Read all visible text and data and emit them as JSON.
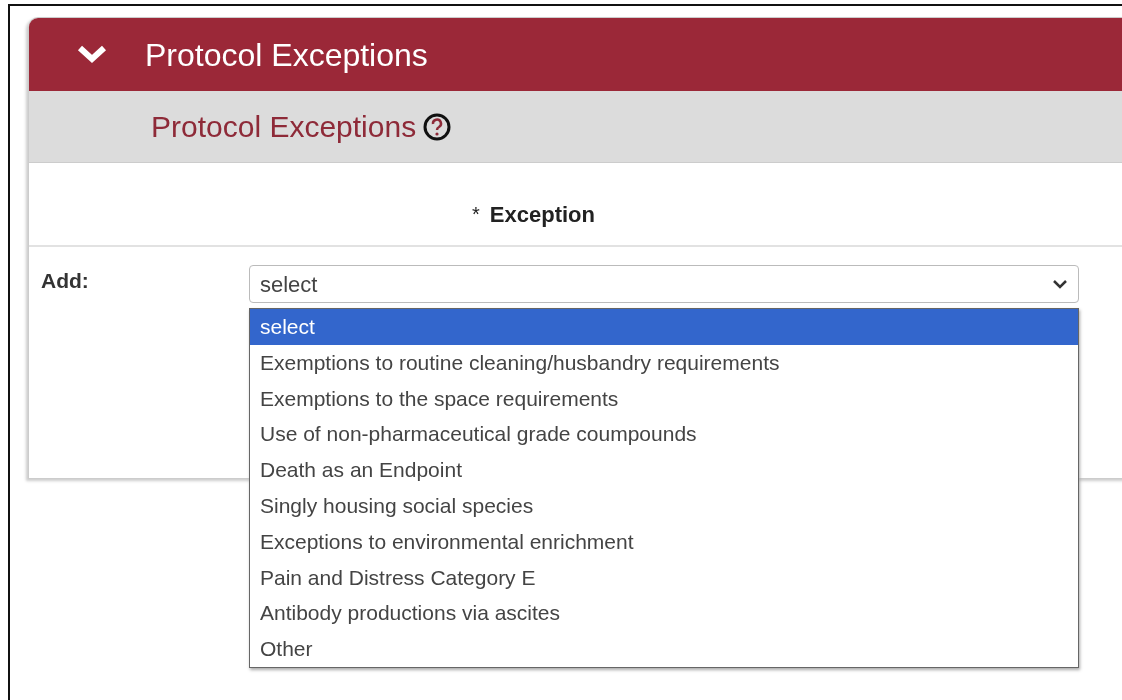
{
  "panel": {
    "title": "Protocol Exceptions",
    "expanded": true
  },
  "section": {
    "title": "Protocol Exceptions"
  },
  "table": {
    "required_mark": "*",
    "column_header": "Exception"
  },
  "add_row": {
    "label": "Add:",
    "select": {
      "value": "select",
      "open": true,
      "options": [
        {
          "label": "select",
          "selected": true
        },
        {
          "label": "Exemptions to routine cleaning/husbandry requirements",
          "selected": false
        },
        {
          "label": "Exemptions to the space requirements",
          "selected": false
        },
        {
          "label": "Use of non-pharmaceutical grade coumpounds",
          "selected": false
        },
        {
          "label": "Death as an Endpoint",
          "selected": false
        },
        {
          "label": "Singly housing social species",
          "selected": false
        },
        {
          "label": "Exceptions to environmental enrichment",
          "selected": false
        },
        {
          "label": "Pain and Distress Category E",
          "selected": false
        },
        {
          "label": "Antibody productions via ascites",
          "selected": false
        },
        {
          "label": "Other",
          "selected": false
        }
      ]
    }
  }
}
